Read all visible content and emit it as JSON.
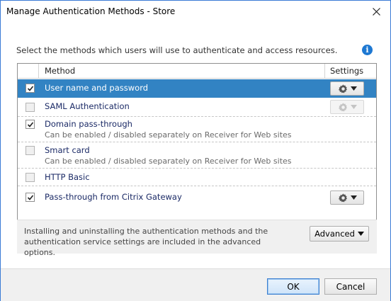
{
  "window": {
    "title": "Manage Authentication Methods - Store"
  },
  "instruction": "Select the methods which users will use to authenticate and access resources.",
  "table": {
    "columns": [
      "Method",
      "Settings"
    ],
    "rows": [
      {
        "name": "User name and password",
        "description": "",
        "checked": true,
        "selected": true,
        "settings": "enabled"
      },
      {
        "name": "SAML Authentication",
        "description": "",
        "checked": false,
        "selected": false,
        "settings": "disabled"
      },
      {
        "name": "Domain pass-through",
        "description": "Can be enabled / disabled separately on Receiver for Web sites",
        "checked": true,
        "selected": false,
        "settings": "none"
      },
      {
        "name": "Smart card",
        "description": "Can be enabled / disabled separately on Receiver for Web sites",
        "checked": false,
        "selected": false,
        "settings": "none"
      },
      {
        "name": "HTTP Basic",
        "description": "",
        "checked": false,
        "selected": false,
        "settings": "none"
      },
      {
        "name": "Pass-through from Citrix Gateway",
        "description": "",
        "checked": true,
        "selected": false,
        "settings": "enabled"
      }
    ]
  },
  "advanced": {
    "text": "Installing and uninstalling the authentication methods and the authentication service settings are included in the advanced options.",
    "button_label": "Advanced"
  },
  "footer": {
    "ok_label": "OK",
    "cancel_label": "Cancel"
  },
  "colors": {
    "selection": "#3283c3",
    "info": "#1e78d2",
    "window_border": "#3a7bd5"
  }
}
